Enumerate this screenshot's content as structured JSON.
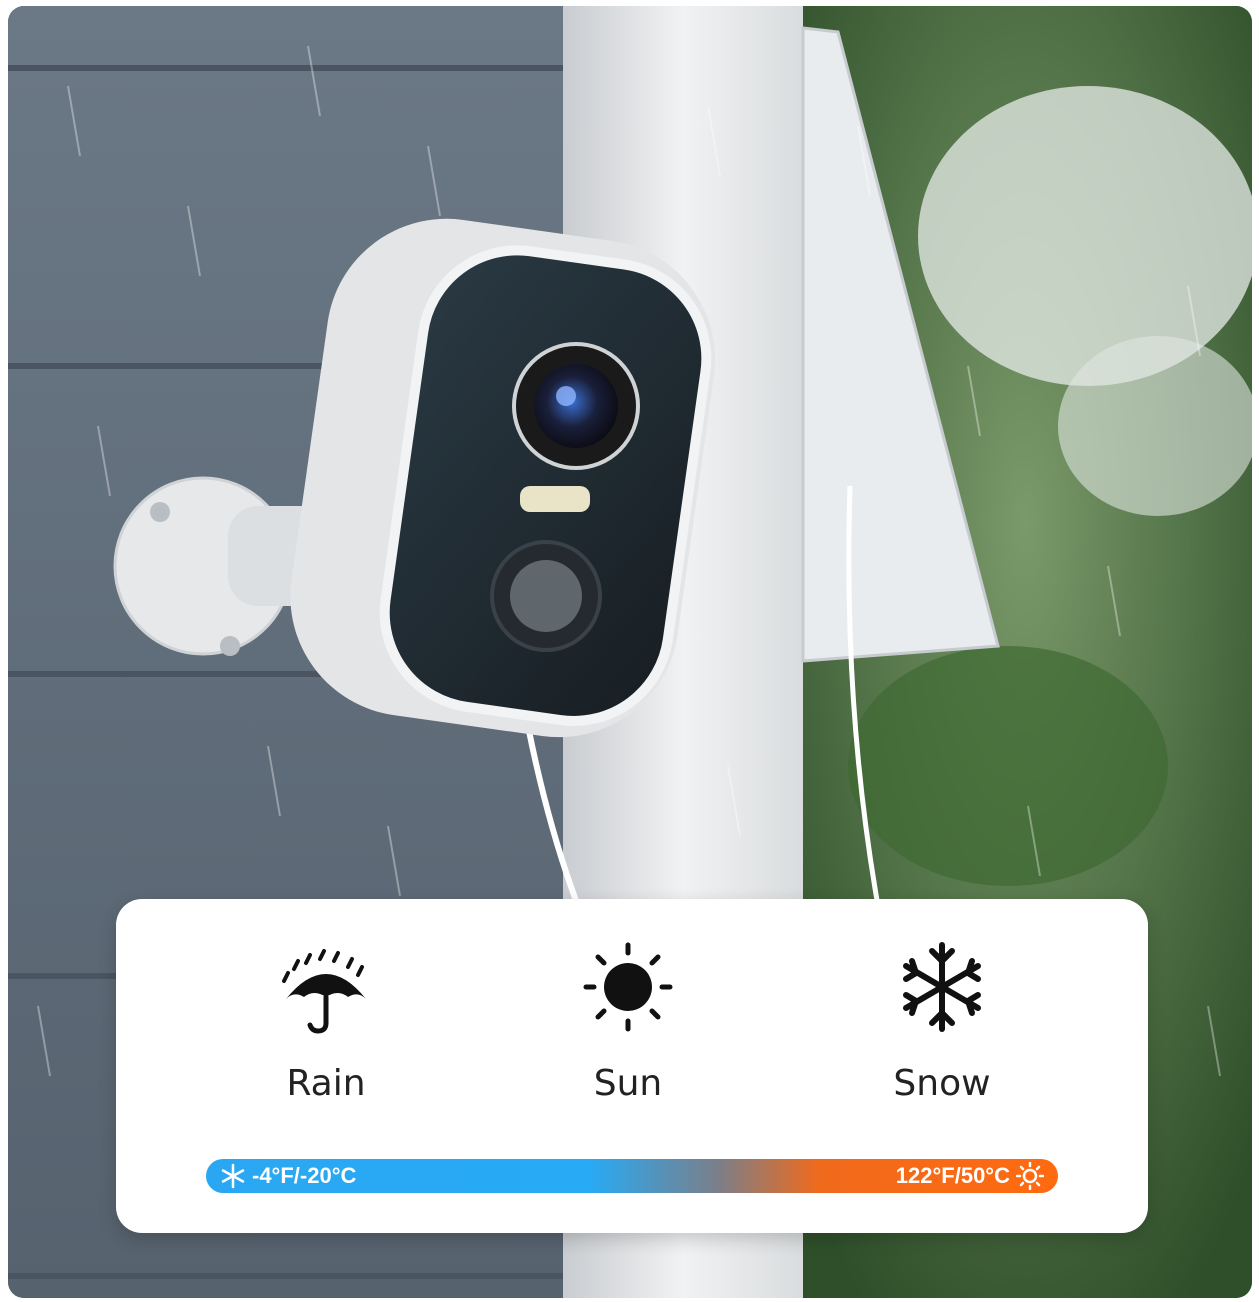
{
  "features": [
    {
      "label": "Rain",
      "icon": "rain-umbrella-icon"
    },
    {
      "label": "Sun",
      "icon": "sun-icon"
    },
    {
      "label": "Snow",
      "icon": "snowflake-icon"
    }
  ],
  "temperature_range": {
    "low": "-4°F/-20°C",
    "high": "122°F/50°C",
    "low_icon": "snowflake-icon",
    "high_icon": "sun-outline-icon",
    "low_color": "#2aa7f2",
    "high_color": "#ff6a10"
  }
}
